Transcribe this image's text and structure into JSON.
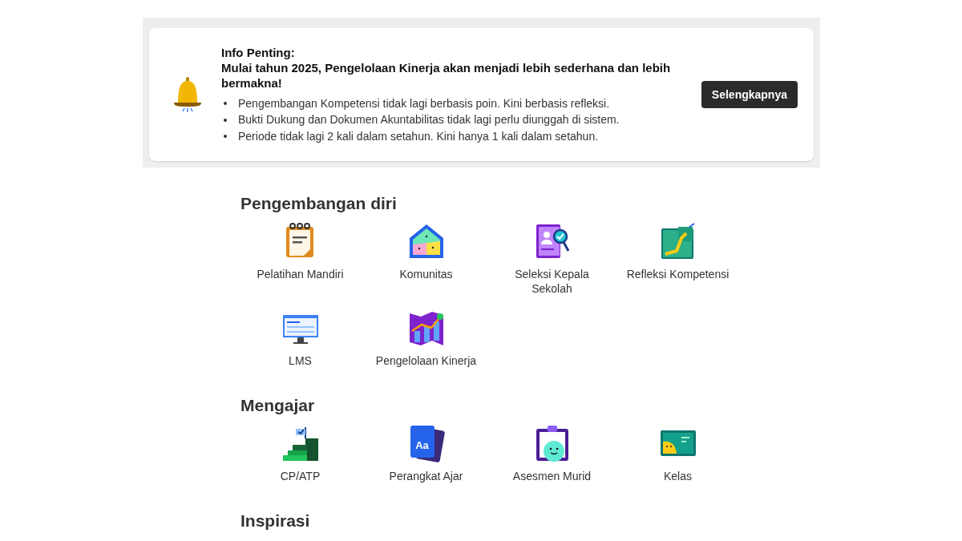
{
  "banner": {
    "title": "Info Penting:",
    "headline": "Mulai tahun 2025, Pengelolaan Kinerja akan menjadi lebih sederhana dan lebih bermakna!",
    "points": [
      "Pengembangan Kompetensi tidak lagi berbasis poin. Kini berbasis refleksi.",
      "Bukti Dukung dan Dokumen Akuntabilitas tidak lagi perlu diunggah di sistem.",
      "Periode tidak lagi 2 kali dalam setahun. Kini hanya 1 kali dalam setahun."
    ],
    "button": "Selengkapnya"
  },
  "sections": [
    {
      "title": "Pengembangan diri",
      "items": [
        {
          "label": "Pelatihan Mandiri"
        },
        {
          "label": "Komunitas"
        },
        {
          "label": "Seleksi Kepala Sekolah"
        },
        {
          "label": "Refleksi Kompetensi"
        },
        {
          "label": "LMS"
        },
        {
          "label": "Pengelolaan Kinerja"
        }
      ]
    },
    {
      "title": "Mengajar",
      "items": [
        {
          "label": "CP/ATP"
        },
        {
          "label": "Perangkat Ajar",
          "icon_text": "Aa"
        },
        {
          "label": "Asesmen Murid"
        },
        {
          "label": "Kelas"
        }
      ]
    },
    {
      "title": "Inspirasi"
    }
  ]
}
